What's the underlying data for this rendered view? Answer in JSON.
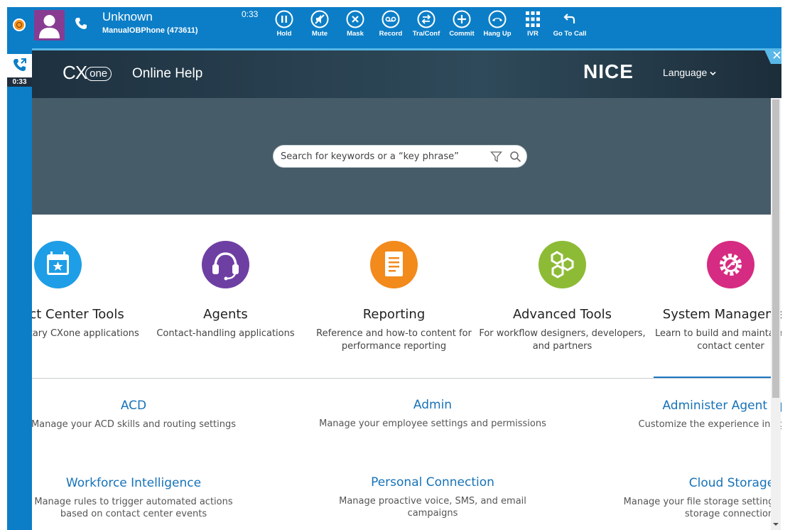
{
  "toolbar": {
    "caller_name": "Unknown",
    "caller_sub": "ManualOBPhone (473611)",
    "timer": "0:33",
    "controls": [
      {
        "label": "Hold",
        "icon": "pause-icon"
      },
      {
        "label": "Mute",
        "icon": "mute-icon"
      },
      {
        "label": "Mask",
        "icon": "mask-icon"
      },
      {
        "label": "Record",
        "icon": "record-icon"
      },
      {
        "label": "Tra/Conf",
        "icon": "transfer-icon"
      },
      {
        "label": "Commit",
        "icon": "commit-icon"
      },
      {
        "label": "Hang Up",
        "icon": "hang-up-icon"
      },
      {
        "label": "IVR",
        "icon": "keypad-icon"
      },
      {
        "label": "Go To Call",
        "icon": "go-to-call-icon"
      }
    ],
    "status_color": "#f7941d",
    "bar_color": "#0c7ec7"
  },
  "left_strip": {
    "timer": "0:33"
  },
  "help_header": {
    "logo_cx": "CX",
    "logo_one": "one",
    "title": "Online Help",
    "brand": "NICE",
    "language_label": "Language"
  },
  "search": {
    "placeholder": "Search for keywords or a “key phrase”"
  },
  "categories": [
    {
      "title": "Contact Center Tools",
      "desc": "Supplementary CXone applications",
      "color": "#1e9ee6",
      "icon": "calendar-star-icon"
    },
    {
      "title": "Agents",
      "desc": "Contact-handling applications",
      "color": "#6e3fa3",
      "icon": "headset-icon"
    },
    {
      "title": "Reporting",
      "desc": "Reference and how-to content for performance reporting",
      "color": "#f28a1c",
      "icon": "document-icon"
    },
    {
      "title": "Advanced Tools",
      "desc": "For workflow designers, developers, and partners",
      "color": "#8dbb36",
      "icon": "hexagon-nodes-icon"
    },
    {
      "title": "System Management",
      "desc": "Learn to build and maintain your contact center",
      "color": "#d62b82",
      "icon": "gear-wrench-icon"
    }
  ],
  "links": [
    {
      "title": "ACD",
      "desc": "Manage your ACD skills and routing settings"
    },
    {
      "title": "Admin",
      "desc": "Manage your employee settings and permissions"
    },
    {
      "title": "Administer Agent Apps",
      "desc": "Customize the experience in agent apps"
    },
    {
      "title": "Workforce Intelligence",
      "desc": "Manage rules to trigger automated actions based on contact center events"
    },
    {
      "title": "Personal Connection",
      "desc": "Manage proactive voice, SMS, and email campaigns"
    },
    {
      "title": "Cloud Storage",
      "desc": "Manage your file storage settings and external storage connections"
    }
  ]
}
